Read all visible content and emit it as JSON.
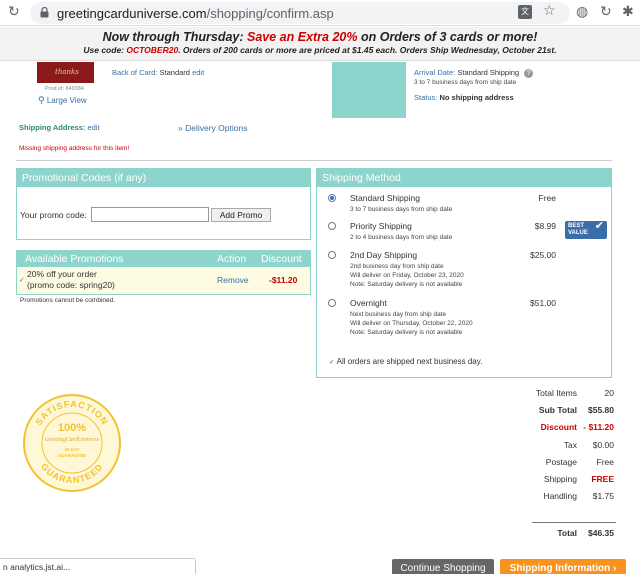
{
  "browser": {
    "url_host": "greetingcarduniverse.com",
    "url_path": "/shopping/confirm.asp"
  },
  "banner": {
    "line1_prefix": "Now through Thursday: ",
    "line1_highlight": "Save an Extra 20%",
    "line1_suffix": " on Orders of 3 cards or more!",
    "line2_prefix": "Use code: ",
    "line2_code": "OCTOBER20",
    "line2_suffix": ".  Orders of 200 cards or more are priced at $1.45 each.  Orders Ship Wednesday, October 21st."
  },
  "product": {
    "thumb_text": "thanks",
    "prod_id": "Prod id: 849384",
    "large_view": "Large View",
    "back_of_card_label": "Back of Card: ",
    "back_of_card_value": "Standard",
    "back_of_card_edit": "edit",
    "arrival_label": "Arrival Date: ",
    "arrival_value": "Standard Shipping",
    "arrival_sub": "3 to 7 business days from ship date",
    "status_label": "Status: ",
    "status_value": "No shipping address",
    "shipping_address_label": "Shipping Address: ",
    "shipping_address_edit": "edit",
    "delivery_options": "» Delivery Options",
    "missing_address": "Missing shipping address for this item!"
  },
  "promo_codes": {
    "title": "Promotional Codes (if any)",
    "input_label": "Your promo code:",
    "input_value": "",
    "button": "Add Promo"
  },
  "available_promotions": {
    "headers": {
      "title": "Available Promotions",
      "action": "Action",
      "discount": "Discount"
    },
    "row": {
      "line1": "20% off your order",
      "line2": "(promo code: spring20)",
      "action": "Remove",
      "amount": "-$11.20"
    },
    "note": "Promotions cannot be combined."
  },
  "shipping_method": {
    "title": "Shipping Method",
    "options": [
      {
        "name": "Standard Shipping",
        "sub1": "3 to 7 business days from ship date",
        "sub2": "",
        "sub3": "",
        "price": "Free",
        "selected": true
      },
      {
        "name": "Priority Shipping",
        "sub1": "2 to 4 business days from ship date",
        "sub2": "",
        "sub3": "",
        "price": "$8.99",
        "selected": false
      },
      {
        "name": "2nd Day Shipping",
        "sub1": "2nd business day from ship date",
        "sub2": "Will deliver on Friday, October 23, 2020",
        "sub3": "Note: Saturday delivery is not available",
        "price": "$25.00",
        "selected": false
      },
      {
        "name": "Overnight",
        "sub1": "Next business day from ship date",
        "sub2": "Will deliver on Thursday, October 22, 2020",
        "sub3": "Note: Saturday delivery is not available",
        "price": "$51.00",
        "selected": false
      }
    ],
    "best_value_line1": "BEST",
    "best_value_line2": "VALUE",
    "note": "All orders are shipped next business day."
  },
  "seal": {
    "top_text": "SATISFACTION",
    "percent": "100%",
    "brand": "GreetingCardUniverse",
    "days_line1": "30-DAY",
    "days_line2": "GUARANTEE",
    "bottom_text": "GUARANTEED"
  },
  "totals": {
    "rows": [
      {
        "label": "Total Items",
        "value": "20"
      },
      {
        "label": "Sub Total",
        "value": "$55.80"
      },
      {
        "label": "Discount",
        "value": "- $11.20"
      },
      {
        "label": "Tax",
        "value": "$0.00"
      },
      {
        "label": "Postage",
        "value": "Free"
      },
      {
        "label": "Shipping",
        "value": "FREE"
      },
      {
        "label": "Handling",
        "value": "$1.75"
      }
    ],
    "total_label": "Total",
    "total_value": "$46.35"
  },
  "footer": {
    "status_toast": "n analytics.jst.ai...",
    "continue_shopping": "Continue Shopping",
    "shipping_information": "Shipping Information ›"
  },
  "colors": {
    "teal": "#8dd5cc",
    "link_blue": "#3a6ea5",
    "alert_red": "#cc0000",
    "button_orange": "#f7931e",
    "button_gray": "#666666"
  }
}
